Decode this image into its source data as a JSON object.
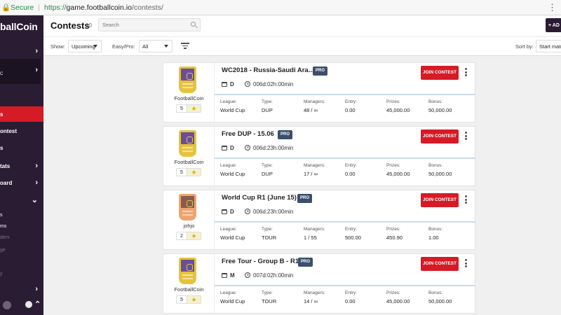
{
  "browser": {
    "secure_label": "Secure",
    "url_protocol": "https://",
    "url_host": "game.footballcoin.io",
    "url_path": "/contests/"
  },
  "sidebar": {
    "logo_text": "ballCoin",
    "user_line_1": "",
    "user_line_2": "C",
    "items": [
      {
        "label": "",
        "has_chevron": true
      },
      {
        "label": "s",
        "active": true
      },
      {
        "label": "ontest"
      },
      {
        "label": "s"
      },
      {
        "label": "tats",
        "has_chevron": true
      },
      {
        "label": "oard",
        "has_chevron": true
      },
      {
        "label": "",
        "has_chevron": true
      },
      {
        "label": "s"
      },
      {
        "label": "ms"
      },
      {
        "label": "ders"
      },
      {
        "label": "ge"
      },
      {
        "label": "y"
      },
      {
        "label": "",
        "has_chevron": true
      }
    ]
  },
  "header": {
    "title": "Contests",
    "count": "10",
    "search_placeholder": "Search",
    "add_button_label": "+ AD"
  },
  "filters": {
    "show_label": "Show:",
    "show_value": "Upcoming",
    "easy_pro_label": "Easy/Pro:",
    "easy_pro_value": "All",
    "sort_label": "Sort by:",
    "sort_value": "Start matc"
  },
  "labels": {
    "league": "League:",
    "type": "Type:",
    "managers": "Managers:",
    "entry": "Entry:",
    "prizes": "Prizes:",
    "bonus": "Bonus:",
    "join": "JOIN CONTEST",
    "pro": "PRO"
  },
  "contests": [
    {
      "title": "WC2018 - Russia-Saudi Ara...",
      "owner": "FootballCoin",
      "rating": "5",
      "level": "D",
      "countdown": "006d:02h:00min",
      "league": "World Cup",
      "type": "DUP",
      "managers": "48 / ∞",
      "entry": "0.00",
      "prizes": "45,000.00",
      "bonus": "50,000.00",
      "card_color": "gold"
    },
    {
      "title": "Free DUP - 15.06",
      "owner": "FootballCoin",
      "rating": "5",
      "level": "D",
      "countdown": "006d:23h:00min",
      "league": "World Cup",
      "type": "DUP",
      "managers": "17 / ∞",
      "entry": "0.00",
      "prizes": "45,000.00",
      "bonus": "50,000.00",
      "card_color": "gold"
    },
    {
      "title": "World Cup R1 (June 15)",
      "owner": "johjo",
      "rating": "2",
      "level": "D",
      "countdown": "006d:23h:00min",
      "league": "World Cup",
      "type": "TOUR",
      "managers": "1 / 55",
      "entry": "500.00",
      "prizes": "450.90",
      "bonus": "1.00",
      "card_color": "orange"
    },
    {
      "title": "Free Tour - Group B - R1",
      "owner": "FootballCoin",
      "rating": "5",
      "level": "M",
      "countdown": "007d:02h:00min",
      "league": "World Cup",
      "type": "TOUR",
      "managers": "14 / ∞",
      "entry": "0.00",
      "prizes": "45,000.00",
      "bonus": "50,000.00",
      "card_color": "gold"
    }
  ]
}
